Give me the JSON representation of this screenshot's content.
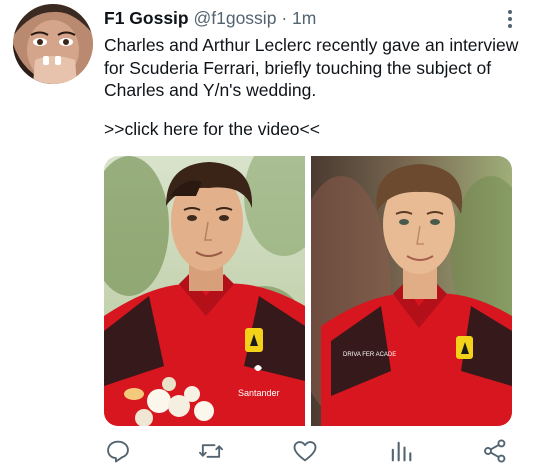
{
  "tweet": {
    "display_name": "F1 Gossip",
    "handle": "@f1gossip",
    "separator": "·",
    "time": "1m",
    "text": "Charles and Arthur Leclerc recently gave an interview for Scuderia Ferrari, briefly touching the subject of Charles and Y/n's wedding.",
    "link_text": ">>click here for the video<<"
  },
  "media": {
    "left_photo": {
      "shirt_text": "Santander"
    },
    "right_photo": {
      "shirt_text": "DRIVA FER ACADE"
    }
  },
  "actions": [
    "reply-icon",
    "retweet-icon",
    "like-icon",
    "stats-icon",
    "share-icon"
  ],
  "colors": {
    "icon": "#536471",
    "text": "#0f1419",
    "ferrari_red": "#d8161f"
  }
}
